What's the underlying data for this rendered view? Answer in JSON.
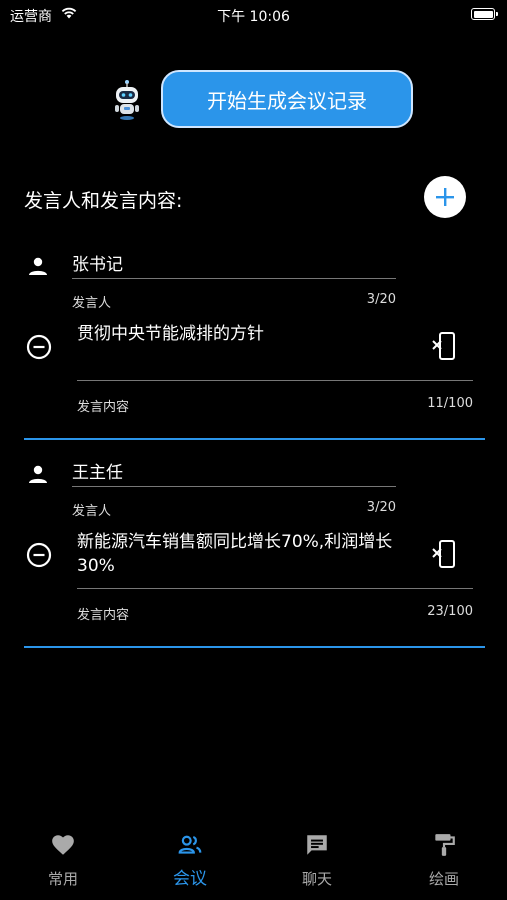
{
  "status_bar": {
    "carrier": "运营商",
    "time": "下午 10:06"
  },
  "colors": {
    "accent": "#2b95ea",
    "background": "#000000"
  },
  "header": {
    "generate_label": "开始生成会议记录"
  },
  "section": {
    "title": "发言人和发言内容:"
  },
  "entries": [
    {
      "speaker": "张书记",
      "speaker_helper": "发言人",
      "speaker_count": "3/20",
      "content": "贯彻中央节能减排的方针",
      "content_helper": "发言内容",
      "content_count": "11/100"
    },
    {
      "speaker": "王主任",
      "speaker_helper": "发言人",
      "speaker_count": "3/20",
      "content": "新能源汽车销售额同比增长70%,利润增长30%",
      "content_helper": "发言内容",
      "content_count": "23/100"
    }
  ],
  "tabs": [
    {
      "label": "常用",
      "icon": "heart-icon"
    },
    {
      "label": "会议",
      "icon": "people-icon",
      "active": true
    },
    {
      "label": "聊天",
      "icon": "chat-icon"
    },
    {
      "label": "绘画",
      "icon": "paint-roller-icon"
    }
  ]
}
